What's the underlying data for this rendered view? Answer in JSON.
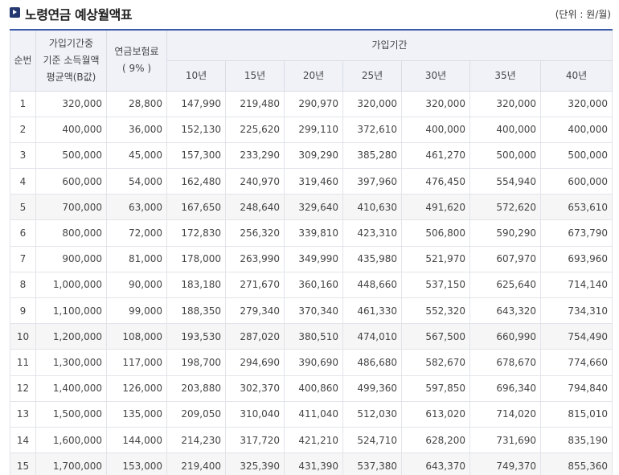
{
  "header": {
    "title": "노령연금 예상월액표",
    "unit": "(단위 : 원/월)",
    "icon": "arrow-right-icon",
    "accent_color": "#25386f"
  },
  "table": {
    "col_index": "순번",
    "col_income_lines": [
      "가입기간중",
      "기준 소득월액",
      "평균액(B값)"
    ],
    "col_premium_lines": [
      "연금보험료",
      "( 9% )"
    ],
    "col_group": "가입기간",
    "period_headers": [
      "10년",
      "15년",
      "20년",
      "25년",
      "30년",
      "35년",
      "40년"
    ],
    "rows": [
      [
        "1",
        "320,000",
        "28,800",
        "147,990",
        "219,480",
        "290,970",
        "320,000",
        "320,000",
        "320,000",
        "320,000"
      ],
      [
        "2",
        "400,000",
        "36,000",
        "152,130",
        "225,620",
        "299,110",
        "372,610",
        "400,000",
        "400,000",
        "400,000"
      ],
      [
        "3",
        "500,000",
        "45,000",
        "157,300",
        "233,290",
        "309,290",
        "385,280",
        "461,270",
        "500,000",
        "500,000"
      ],
      [
        "4",
        "600,000",
        "54,000",
        "162,480",
        "240,970",
        "319,460",
        "397,960",
        "476,450",
        "554,940",
        "600,000"
      ],
      [
        "5",
        "700,000",
        "63,000",
        "167,650",
        "248,640",
        "329,640",
        "410,630",
        "491,620",
        "572,620",
        "653,610"
      ],
      [
        "6",
        "800,000",
        "72,000",
        "172,830",
        "256,320",
        "339,810",
        "423,310",
        "506,800",
        "590,290",
        "673,790"
      ],
      [
        "7",
        "900,000",
        "81,000",
        "178,000",
        "263,990",
        "349,990",
        "435,980",
        "521,970",
        "607,970",
        "693,960"
      ],
      [
        "8",
        "1,000,000",
        "90,000",
        "183,180",
        "271,670",
        "360,160",
        "448,660",
        "537,150",
        "625,640",
        "714,140"
      ],
      [
        "9",
        "1,100,000",
        "99,000",
        "188,350",
        "279,340",
        "370,340",
        "461,330",
        "552,320",
        "643,320",
        "734,310"
      ],
      [
        "10",
        "1,200,000",
        "108,000",
        "193,530",
        "287,020",
        "380,510",
        "474,010",
        "567,500",
        "660,990",
        "754,490"
      ],
      [
        "11",
        "1,300,000",
        "117,000",
        "198,700",
        "294,690",
        "390,690",
        "486,680",
        "582,670",
        "678,670",
        "774,660"
      ],
      [
        "12",
        "1,400,000",
        "126,000",
        "203,880",
        "302,370",
        "400,860",
        "499,360",
        "597,850",
        "696,340",
        "794,840"
      ],
      [
        "13",
        "1,500,000",
        "135,000",
        "209,050",
        "310,040",
        "411,040",
        "512,030",
        "613,020",
        "714,020",
        "815,010"
      ],
      [
        "14",
        "1,600,000",
        "144,000",
        "214,230",
        "317,720",
        "421,210",
        "524,710",
        "628,200",
        "731,690",
        "835,190"
      ],
      [
        "15",
        "1,700,000",
        "153,000",
        "219,400",
        "325,390",
        "431,390",
        "537,380",
        "643,370",
        "749,370",
        "855,360"
      ]
    ]
  }
}
